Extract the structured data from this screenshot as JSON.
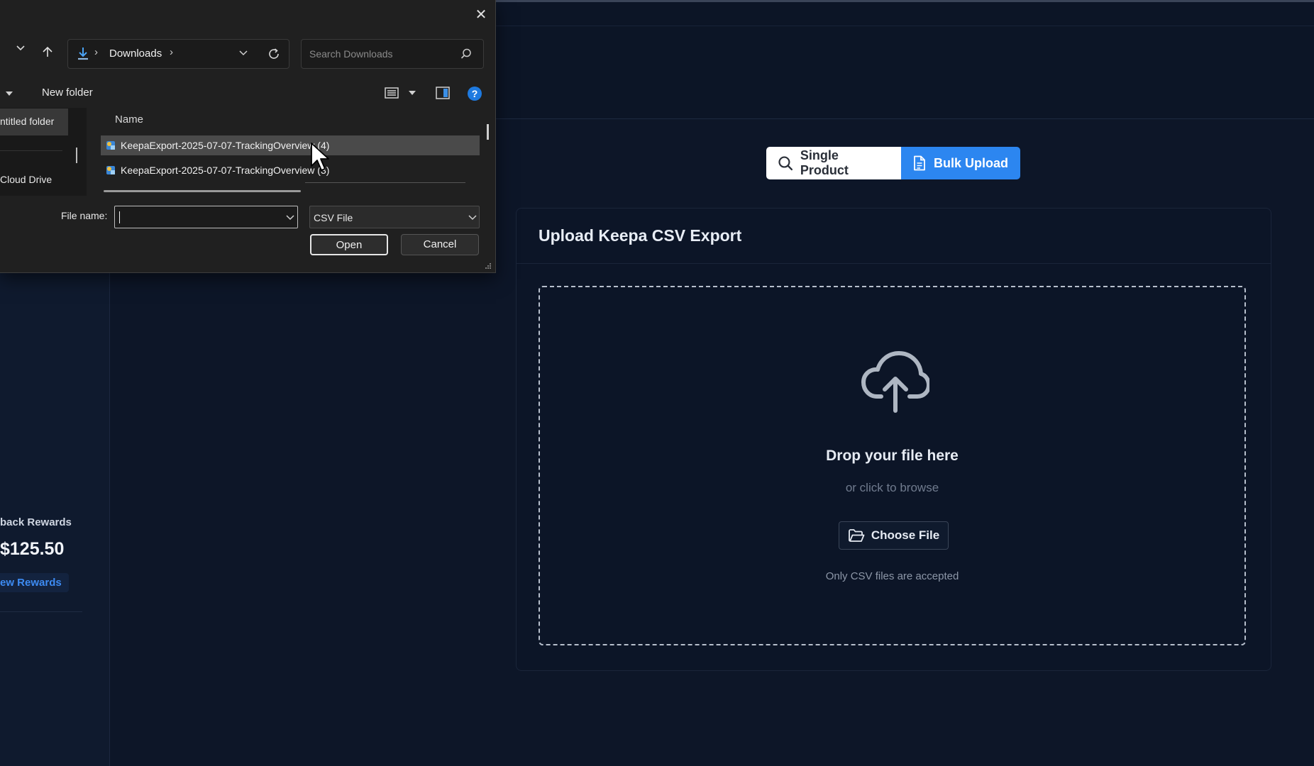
{
  "sidebar": {
    "rewards_title": "back Rewards",
    "rewards_amount": "$125.50",
    "rewards_button": "ew Rewards"
  },
  "mode_toggle": {
    "single_label": "Single Product",
    "bulk_label": "Bulk Upload",
    "active": "Bulk Upload",
    "active_color": "#2c86f0"
  },
  "upload_card": {
    "title": "Upload Keepa CSV Export",
    "drop_title": "Drop your file here",
    "drop_sub": "or click to browse",
    "choose_button": "Choose File",
    "note": "Only CSV files are accepted",
    "icons": [
      "cloud-upload-icon",
      "folder-icon"
    ]
  },
  "file_dialog": {
    "address": "Downloads",
    "search_placeholder": "Search Downloads",
    "toolbar": {
      "new_folder": "New folder"
    },
    "nav_pane": {
      "items": [
        "ntitled folder",
        "Cloud Drive"
      ]
    },
    "column_header": "Name",
    "files": [
      {
        "name": "KeepaExport-2025-07-07-TrackingOverview (4)",
        "selected": true
      },
      {
        "name": "KeepaExport-2025-07-07-TrackingOverview (3)",
        "selected": false
      }
    ],
    "file_name_label": "File name:",
    "file_name_value": "",
    "file_type": "CSV File",
    "open_button": "Open",
    "cancel_button": "Cancel"
  }
}
